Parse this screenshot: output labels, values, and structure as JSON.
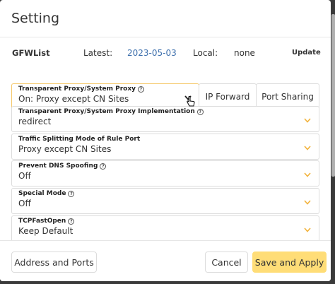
{
  "dialog": {
    "title": "Setting"
  },
  "gfwlist": {
    "name": "GFWList",
    "latest_label": "Latest:",
    "latest_value": "2023-05-03",
    "local_label": "Local:",
    "local_value": "none",
    "update_label": "Update"
  },
  "fields": [
    {
      "label": "Transparent Proxy/System Proxy",
      "value": "On: Proxy except CN Sites",
      "help_icon": "question-circle-icon"
    },
    {
      "label": "Transparent Proxy/System Proxy Implementation",
      "value": "redirect",
      "help_icon": "question-circle-icon"
    },
    {
      "label": "Traffic Splitting Mode of Rule Port",
      "value": "Proxy except CN Sites"
    },
    {
      "label": "Prevent DNS Spoofing",
      "value": "Off",
      "help_icon": "question-circle-icon"
    },
    {
      "label": "Special Mode",
      "value": "Off",
      "help_icon": "question-circle-icon"
    },
    {
      "label": "TCPFastOpen",
      "value": "Keep Default",
      "help_icon": "question-circle-icon"
    }
  ],
  "side_buttons": {
    "ip_forward": "IP Forward",
    "port_sharing": "Port Sharing"
  },
  "footer": {
    "address_ports": "Address and Ports",
    "cancel": "Cancel",
    "save_apply": "Save and Apply"
  },
  "colors": {
    "accent": "#ffdd77",
    "link": "#3e70ad",
    "chevron": "#f2b33d"
  }
}
